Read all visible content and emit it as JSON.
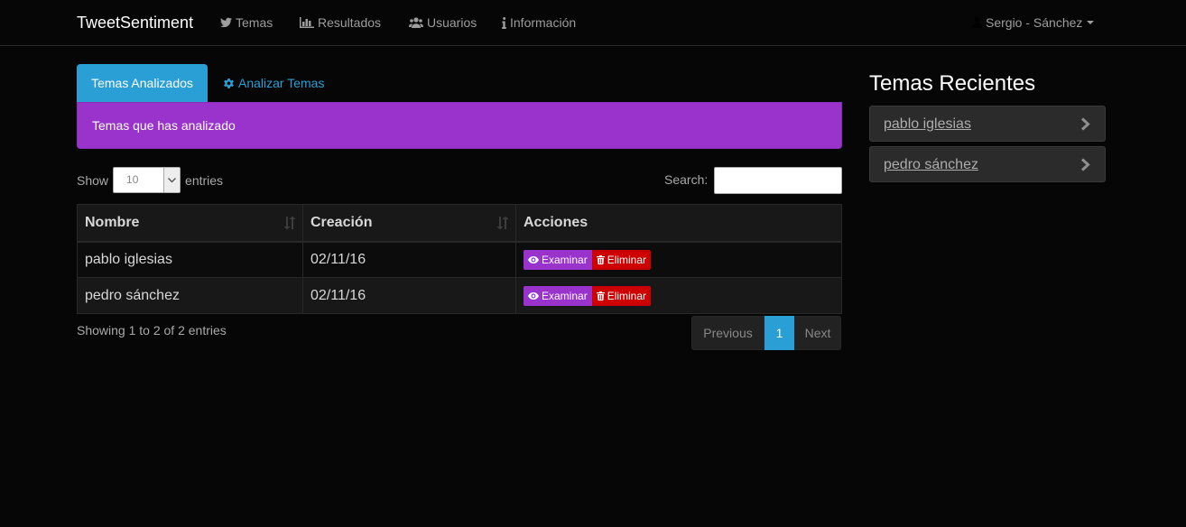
{
  "navbar": {
    "brand": "TweetSentiment",
    "items": [
      {
        "label": "Temas",
        "icon": "twitter-icon"
      },
      {
        "label": "Resultados",
        "icon": "bar-chart-icon"
      },
      {
        "label": "Usuarios",
        "icon": "users-icon"
      },
      {
        "label": "Información",
        "icon": "info-icon"
      }
    ],
    "user": "Sergio - Sánchez"
  },
  "tabs": {
    "active": "Temas Analizados",
    "other": "Analizar Temas"
  },
  "alert": "Temas que has analizado",
  "table_controls": {
    "show_label": "Show",
    "entries_label": "entries",
    "length_value": "10",
    "search_label": "Search:",
    "search_value": ""
  },
  "table": {
    "columns": [
      "Nombre",
      "Creación",
      "Acciones"
    ],
    "rows": [
      {
        "nombre": "pablo iglesias",
        "creacion": "02/11/16"
      },
      {
        "nombre": "pedro sánchez",
        "creacion": "02/11/16"
      }
    ],
    "examinar_label": "Examinar",
    "eliminar_label": "Eliminar"
  },
  "info": "Showing 1 to 2 of 2 entries",
  "pagination": {
    "previous": "Previous",
    "current": "1",
    "next": "Next"
  },
  "sidebar": {
    "title": "Temas Recientes",
    "items": [
      {
        "label": "pablo iglesias"
      },
      {
        "label": "pedro sánchez"
      }
    ]
  },
  "colors": {
    "primary": "#2a9fd6",
    "purple": "#9933cc",
    "danger": "#cc0000",
    "background": "#060606"
  }
}
